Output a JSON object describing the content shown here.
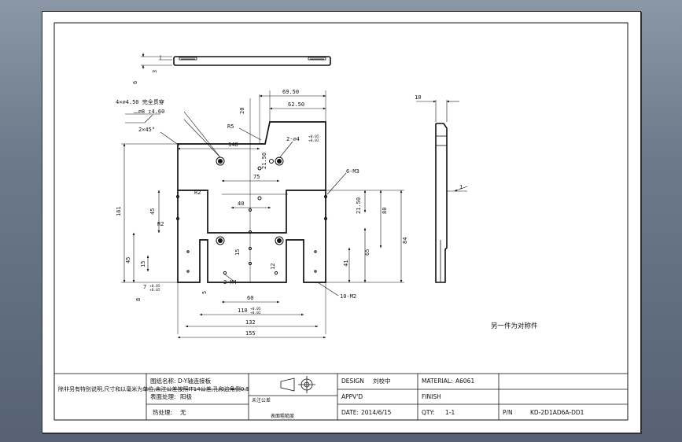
{
  "drawing": {
    "colors": {
      "line": "#111111",
      "sheet": "#ffffff",
      "background": "#6c7a8b"
    },
    "notes": {
      "holes_through": "4×∅4.50 完全贯穿",
      "counterbore": "⌴∅8 ↧4.60",
      "chamfer": "2×45°",
      "dowel": "2-∅4",
      "dowel_tol_upper": "+0.05",
      "dowel_tol_lower": "+0.02",
      "thread_6": "6-M3",
      "thread_2": "2-M4",
      "thread_10": "10-M2",
      "radius_5": "R5",
      "radius_2a": "R2",
      "radius_2b": "R2",
      "other_side": "另一件为对称件"
    },
    "dims": {
      "top_thick": "6",
      "top_small": "3",
      "d_69_5": "69.50",
      "d_62_5": "62.50",
      "d_20": "20",
      "d_148": "148",
      "d_21_5a": "21.50",
      "d_75": "75",
      "d_40": "40",
      "d_161": "161",
      "d_45a": "45",
      "d_45b": "45",
      "d_15a": "15",
      "d_15b": "15",
      "d_21_5b": "21.50",
      "d_80": "80",
      "d_84": "84",
      "d_65": "65",
      "d_41": "41",
      "d_12": "12",
      "d_7": "7",
      "d_7_tol_u": "+0.05",
      "d_7_tol_l": "+0.02",
      "d_8": "8",
      "d_5": "5",
      "d_60": "60",
      "d_110": "110",
      "d_110_tol_u": "+0.05",
      "d_110_tol_l": "+0.02",
      "d_132": "132",
      "d_155": "155",
      "side_10": "10",
      "side_1": "1"
    },
    "title_block": {
      "tech_req": "除非另有特别说明,尺寸和以毫米为单位,未注公差按照IT14公差,孔和边角倒0.5",
      "part_name_label": "图纸名称:",
      "part_name": "D-Y轴连接板",
      "surface_label": "表面处理:",
      "surface": "阳极",
      "heat_label": "热处理:",
      "heat": "无",
      "projection_label": "表面粗糙度",
      "general_label": "未注公差",
      "design_label": "DESIGN",
      "design_value": "刘校中",
      "material_label": "MATERIAL:",
      "material_value": "A6061",
      "appvd_label": "APPV'D",
      "finish_label": "FINISH",
      "date_label": "DATE:",
      "date_value": "2014/6/15",
      "qty_label": "QTY:",
      "qty_value": "1-1",
      "pn_label": "P/N",
      "pn_value": "KD-2D1AD6A-DD1"
    }
  }
}
